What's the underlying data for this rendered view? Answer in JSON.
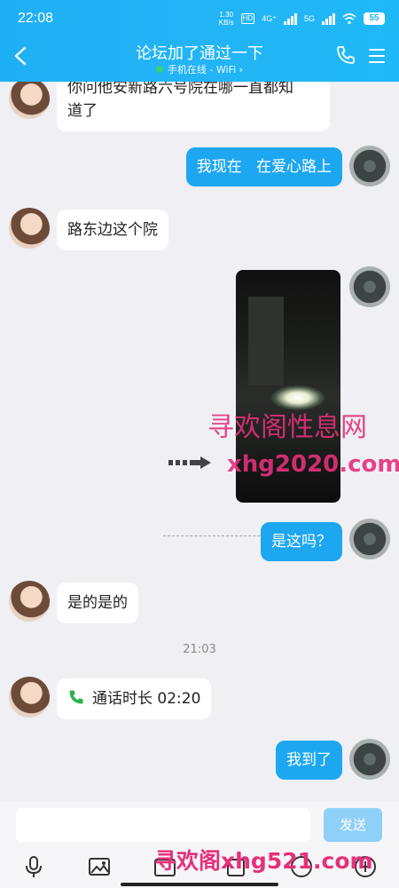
{
  "status": {
    "time": "22:08",
    "net_speed_top": "1.30",
    "net_speed_bottom": "KB/s",
    "hd": "HD",
    "net1": "4G⁺",
    "net2": "5G",
    "battery": "55"
  },
  "header": {
    "title": "论坛加了通过一下",
    "subtitle": "手机在线 - WiFi ›"
  },
  "messages": [
    {
      "side": "left",
      "text_line1": "你问他安新路六号院在哪一直都知",
      "text_line2": "道了"
    },
    {
      "side": "right",
      "text": "我现在   在爱心路上"
    },
    {
      "side": "left",
      "text": "路东边这个院"
    },
    {
      "side": "right",
      "type": "video"
    },
    {
      "side": "right",
      "text": "是这吗？"
    },
    {
      "side": "left",
      "text": "是的是的"
    },
    {
      "type": "timestamp",
      "text": "21:03"
    },
    {
      "side": "left",
      "type": "call",
      "text": "通话时长 02:20"
    },
    {
      "side": "right",
      "text": "我到了"
    }
  ],
  "watermarks": {
    "line1": "寻欢阁性息网",
    "line2": "xhg2020.com",
    "line3": "寻欢阁xhg521.com"
  },
  "input": {
    "send_label": "发送"
  },
  "colors": {
    "header": "#1fb0f4",
    "bubble_out": "#1ea7f1",
    "watermark": "#e5307a"
  },
  "icons": [
    "back-icon",
    "phone-icon",
    "menu-icon",
    "mic-icon",
    "image-icon",
    "camera-icon",
    "emoji-icon",
    "plus-icon"
  ]
}
